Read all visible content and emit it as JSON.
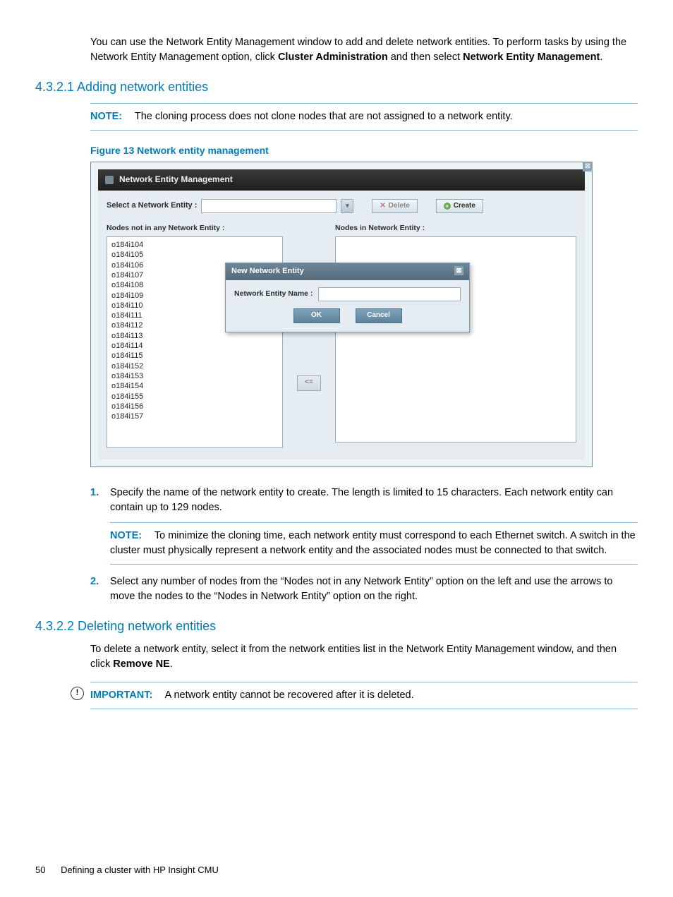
{
  "intro": {
    "text_before": "You can use the Network Entity Management window to add and delete network entities. To perform tasks by using the Network Entity Management option, click ",
    "bold1": "Cluster Administration",
    "mid": " and then select ",
    "bold2": "Network Entity Management",
    "after": "."
  },
  "section1": {
    "heading": "4.3.2.1 Adding network entities",
    "note_label": "NOTE:",
    "note_text": "The cloning process does not clone nodes that are not assigned to a network entity.",
    "figure_caption": "Figure 13 Network entity management"
  },
  "shot": {
    "title": "Network Entity Management",
    "select_label": "Select a Network Entity :",
    "delete_btn": "Delete",
    "create_btn": "Create",
    "left_list_label": "Nodes not in any Network Entity :",
    "right_list_label": "Nodes in Network Entity :",
    "nodes": [
      "o184i104",
      "o184i105",
      "o184i106",
      "o184i107",
      "o184i108",
      "o184i109",
      "o184i110",
      "o184i111",
      "o184i112",
      "o184i113",
      "o184i114",
      "o184i115",
      "o184i152",
      "o184i153",
      "o184i154",
      "o184i155",
      "o184i156",
      "o184i157"
    ],
    "move_right": "=>",
    "move_left": "<=",
    "dialog": {
      "title": "New Network Entity",
      "field_label": "Network Entity Name :",
      "ok": "OK",
      "cancel": "Cancel"
    }
  },
  "steps": {
    "s1": "Specify the name of the network entity to create. The length is limited to 15 characters. Each network entity can contain up to 129 nodes.",
    "s1_note_label": "NOTE:",
    "s1_note_text": "To minimize the cloning time, each network entity must correspond to each Ethernet switch. A switch in the cluster must physically represent a network entity and the associated nodes must be connected to that switch.",
    "s2": "Select any number of nodes from the “Nodes not in any Network Entity” option on the left and use the arrows to move the nodes to the “Nodes in Network Entity” option on the right."
  },
  "section2": {
    "heading": "4.3.2.2 Deleting network entities",
    "para_before": "To delete a network entity, select it from the network entities list in the Network Entity Management window, and then click ",
    "para_bold": "Remove NE",
    "para_after": ".",
    "important_label": "IMPORTANT:",
    "important_text": "A network entity cannot be recovered after it is deleted."
  },
  "footer": {
    "page": "50",
    "chapter": "Defining a cluster with HP Insight CMU"
  }
}
